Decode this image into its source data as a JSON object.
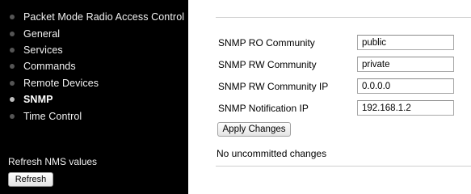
{
  "sidebar": {
    "items": [
      {
        "label": "Packet Mode Radio Access Control",
        "active": false
      },
      {
        "label": "General",
        "active": false
      },
      {
        "label": "Services",
        "active": false
      },
      {
        "label": "Commands",
        "active": false
      },
      {
        "label": "Remote Devices",
        "active": false
      },
      {
        "label": "SNMP",
        "active": true
      },
      {
        "label": "Time Control",
        "active": false
      }
    ],
    "refresh_label": "Refresh NMS values",
    "refresh_button": "Refresh"
  },
  "form": {
    "fields": [
      {
        "label": "SNMP RO Community",
        "value": "public"
      },
      {
        "label": "SNMP RW Community",
        "value": "private"
      },
      {
        "label": "SNMP RW Community IP",
        "value": "0.0.0.0"
      },
      {
        "label": "SNMP Notification IP",
        "value": "192.168.1.2"
      }
    ],
    "apply_button": "Apply Changes",
    "status": "No uncommitted changes"
  },
  "colors": {
    "sidebar_bg": "#000000",
    "sidebar_text": "#ffffff",
    "main_bg": "#ffffff"
  }
}
